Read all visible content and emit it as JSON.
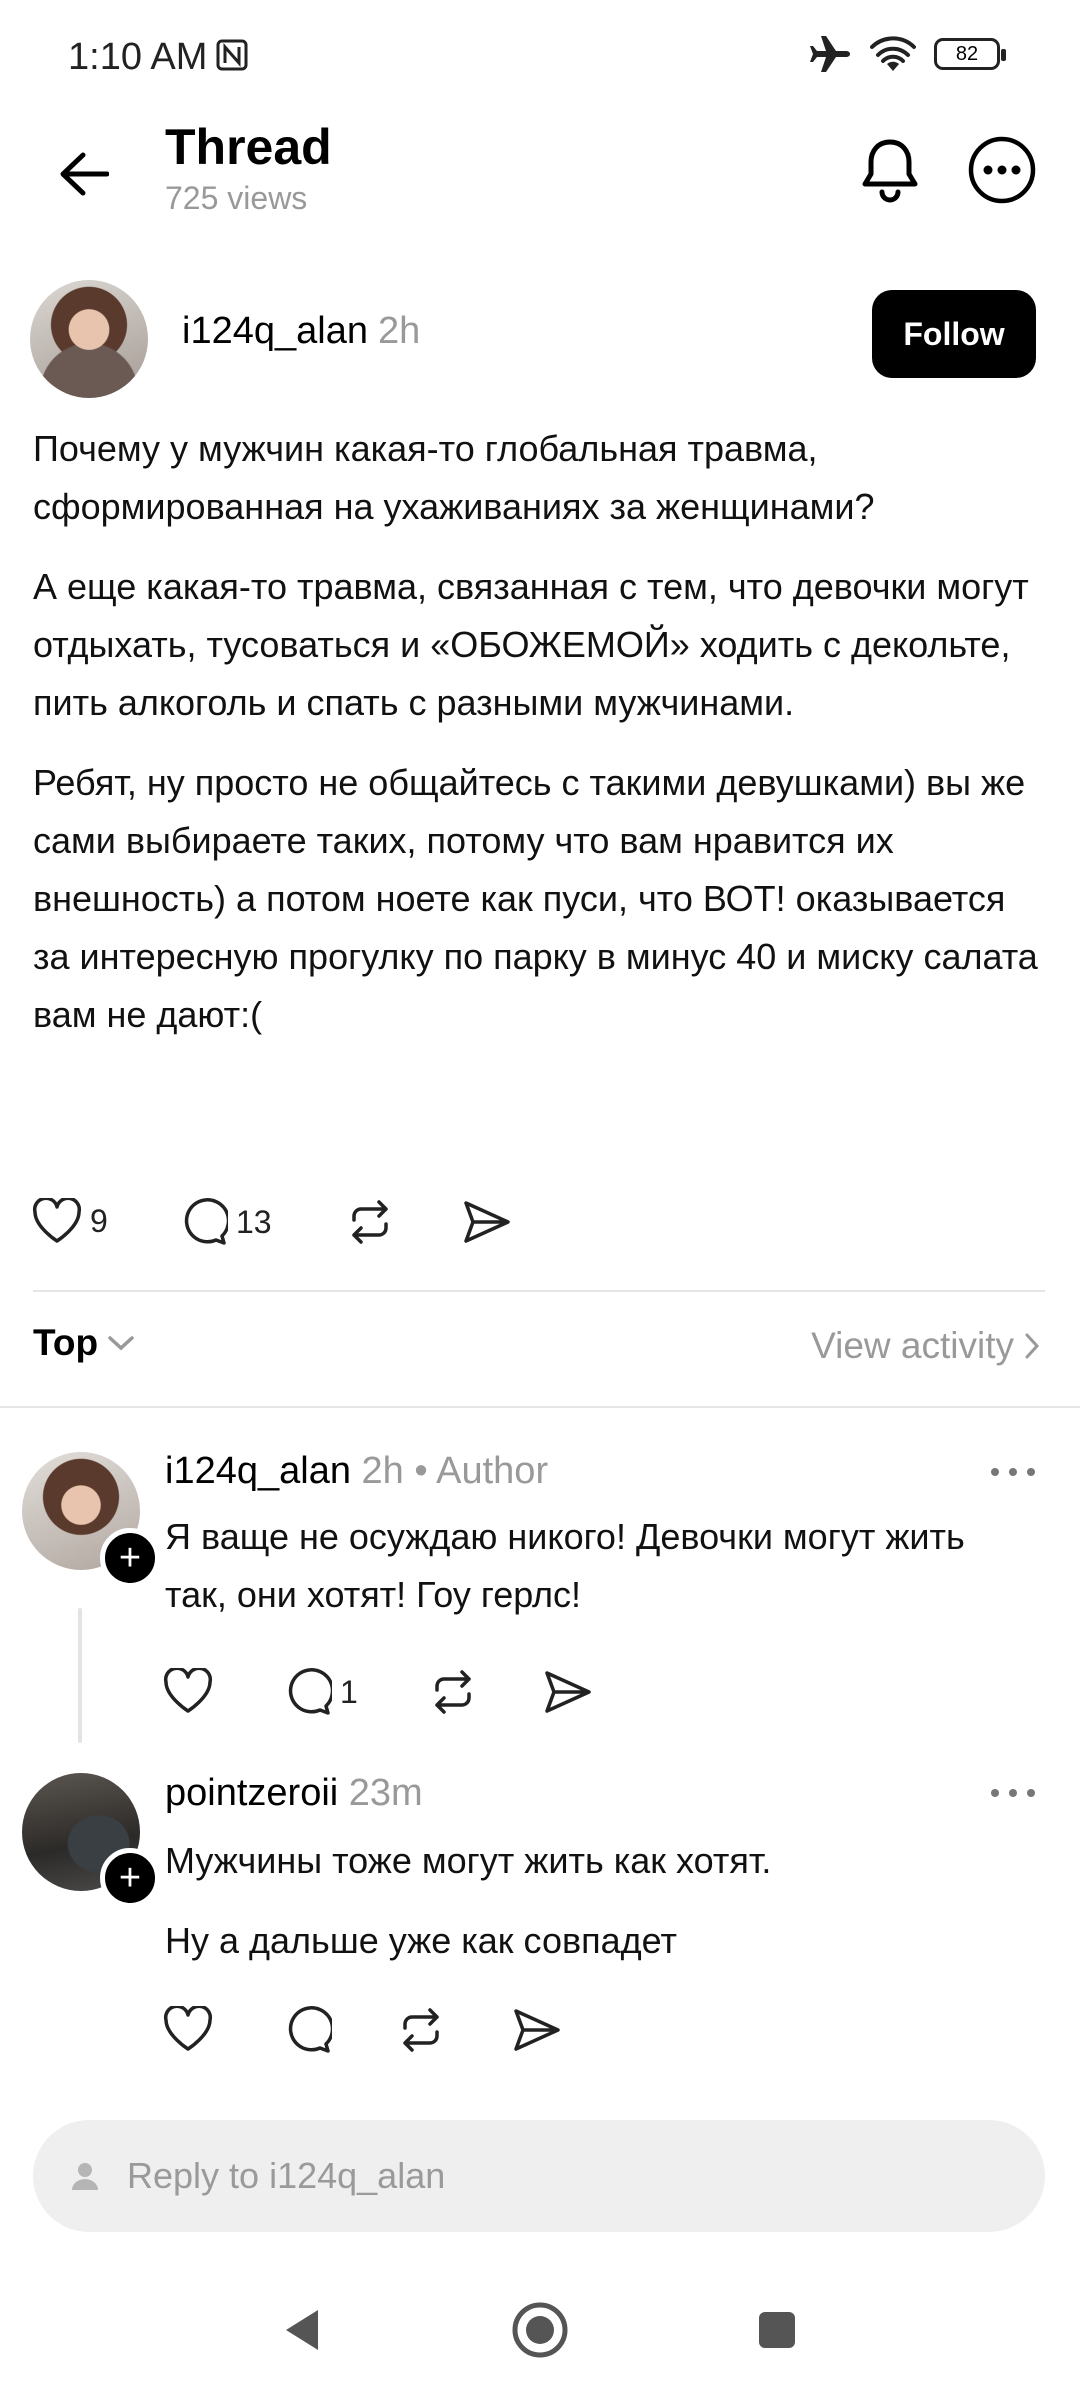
{
  "status_bar": {
    "time": "1:10 AM",
    "battery": "82"
  },
  "header": {
    "title": "Thread",
    "views": "725 views"
  },
  "post": {
    "username": "i124q_alan",
    "time": "2h",
    "follow_label": "Follow",
    "paragraphs": [
      "Почему у мужчин какая-то глобальная травма, сформированная на ухаживаниях за женщинами?",
      "А еще какая-то травма, связанная с тем, что девочки могут отдыхать, тусоваться и «ОБОЖЕМОЙ» ходить с декольте, пить алкоголь и спать с разными мужчинами.",
      "Ребят, ну просто не общайтесь с такими девушками) вы же сами выбираете таких, потому что вам нравится их внешность) а потом ноете как пуси, что ВОТ! оказывается за интересную прогулку по парку в минус 40 и миску салата вам не дают:("
    ],
    "likes": "9",
    "comments": "13"
  },
  "sort": {
    "label": "Top",
    "view_activity": "View activity"
  },
  "replies": [
    {
      "username": "i124q_alan",
      "time": "2h",
      "badge": "• Author",
      "paragraphs": [
        "Я ваще не осуждаю никого! Девочки могут жить так, они хотят! Гоу герлс!"
      ],
      "comments": "1"
    },
    {
      "username": "pointzeroii",
      "time": "23m",
      "badge": "",
      "paragraphs": [
        "Мужчины тоже могут жить как хотят.",
        "Ну а дальше уже как совпадет"
      ],
      "comments": ""
    }
  ],
  "reply_bar": {
    "placeholder": "Reply to i124q_alan"
  },
  "icons": {
    "back": "arrow-left-icon",
    "bell": "bell-icon",
    "more": "more-circle-icon",
    "like": "heart-icon",
    "comment": "comment-bubble-icon",
    "repost": "repost-icon",
    "share": "send-icon"
  },
  "colors": {
    "follow_bg": "#000000",
    "muted_text": "#999999",
    "reply_bar_bg": "#efefef"
  }
}
